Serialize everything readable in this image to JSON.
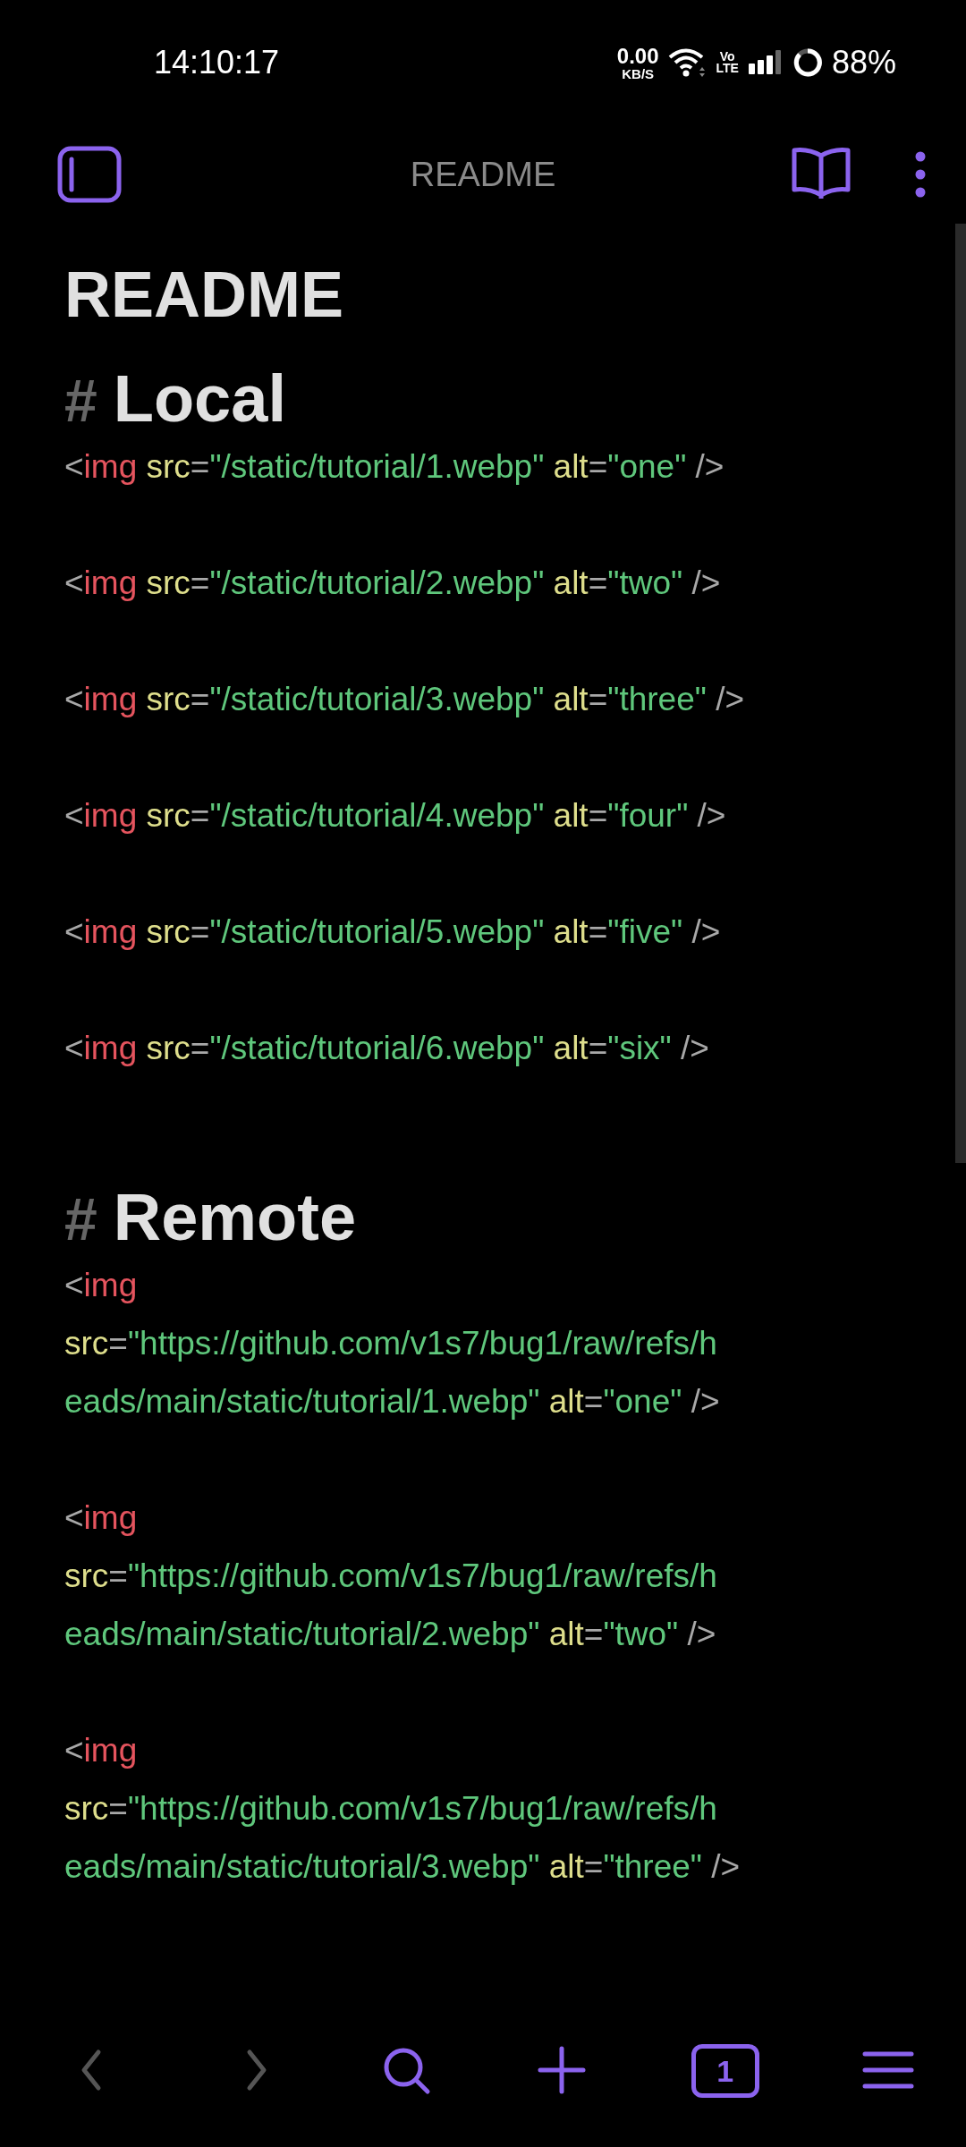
{
  "status_bar": {
    "time": "14:10:17",
    "net_speed": "0.00",
    "net_unit": "KB/S",
    "volte_top": "Vo",
    "volte_bottom": "LTE",
    "battery": "88%"
  },
  "top_bar": {
    "title": "README"
  },
  "document": {
    "title": "README",
    "sections": [
      {
        "marker": "#",
        "heading": "Local",
        "blocks": [
          {
            "lines": [
              [
                {
                  "kind": "punct",
                  "text": "<"
                },
                {
                  "kind": "tag",
                  "text": "img"
                },
                {
                  "kind": "attr",
                  "text": " src"
                },
                {
                  "kind": "punct",
                  "text": "="
                },
                {
                  "kind": "string",
                  "text": "\"/static/tutorial/1.webp\""
                },
                {
                  "kind": "attr",
                  "text": " alt"
                },
                {
                  "kind": "punct",
                  "text": "="
                },
                {
                  "kind": "string",
                  "text": "\"one\""
                },
                {
                  "kind": "punct",
                  "text": " />"
                }
              ]
            ]
          },
          {
            "lines": [
              [
                {
                  "kind": "punct",
                  "text": "<"
                },
                {
                  "kind": "tag",
                  "text": "img"
                },
                {
                  "kind": "attr",
                  "text": " src"
                },
                {
                  "kind": "punct",
                  "text": "="
                },
                {
                  "kind": "string",
                  "text": "\"/static/tutorial/2.webp\""
                },
                {
                  "kind": "attr",
                  "text": " alt"
                },
                {
                  "kind": "punct",
                  "text": "="
                },
                {
                  "kind": "string",
                  "text": "\"two\""
                },
                {
                  "kind": "punct",
                  "text": " />"
                }
              ]
            ]
          },
          {
            "lines": [
              [
                {
                  "kind": "punct",
                  "text": "<"
                },
                {
                  "kind": "tag",
                  "text": "img"
                },
                {
                  "kind": "attr",
                  "text": " src"
                },
                {
                  "kind": "punct",
                  "text": "="
                },
                {
                  "kind": "string",
                  "text": "\"/static/tutorial/3.webp\""
                },
                {
                  "kind": "attr",
                  "text": " alt"
                },
                {
                  "kind": "punct",
                  "text": "="
                },
                {
                  "kind": "string",
                  "text": "\"three\""
                },
                {
                  "kind": "punct",
                  "text": " />"
                }
              ]
            ]
          },
          {
            "lines": [
              [
                {
                  "kind": "punct",
                  "text": "<"
                },
                {
                  "kind": "tag",
                  "text": "img"
                },
                {
                  "kind": "attr",
                  "text": " src"
                },
                {
                  "kind": "punct",
                  "text": "="
                },
                {
                  "kind": "string",
                  "text": "\"/static/tutorial/4.webp\""
                },
                {
                  "kind": "attr",
                  "text": " alt"
                },
                {
                  "kind": "punct",
                  "text": "="
                },
                {
                  "kind": "string",
                  "text": "\"four\""
                },
                {
                  "kind": "punct",
                  "text": " />"
                }
              ]
            ]
          },
          {
            "lines": [
              [
                {
                  "kind": "punct",
                  "text": "<"
                },
                {
                  "kind": "tag",
                  "text": "img"
                },
                {
                  "kind": "attr",
                  "text": " src"
                },
                {
                  "kind": "punct",
                  "text": "="
                },
                {
                  "kind": "string",
                  "text": "\"/static/tutorial/5.webp\""
                },
                {
                  "kind": "attr",
                  "text": " alt"
                },
                {
                  "kind": "punct",
                  "text": "="
                },
                {
                  "kind": "string",
                  "text": "\"five\""
                },
                {
                  "kind": "punct",
                  "text": " />"
                }
              ]
            ]
          },
          {
            "lines": [
              [
                {
                  "kind": "punct",
                  "text": "<"
                },
                {
                  "kind": "tag",
                  "text": "img"
                },
                {
                  "kind": "attr",
                  "text": " src"
                },
                {
                  "kind": "punct",
                  "text": "="
                },
                {
                  "kind": "string",
                  "text": "\"/static/tutorial/6.webp\""
                },
                {
                  "kind": "attr",
                  "text": " alt"
                },
                {
                  "kind": "punct",
                  "text": "="
                },
                {
                  "kind": "string",
                  "text": "\"six\""
                },
                {
                  "kind": "punct",
                  "text": " />"
                }
              ]
            ]
          }
        ]
      },
      {
        "marker": "#",
        "heading": "Remote",
        "blocks": [
          {
            "lines": [
              [
                {
                  "kind": "punct",
                  "text": "<"
                },
                {
                  "kind": "tag",
                  "text": "img"
                }
              ],
              [
                {
                  "kind": "attr",
                  "text": "src"
                },
                {
                  "kind": "punct",
                  "text": "="
                },
                {
                  "kind": "string",
                  "text": "\"https://github.com/v1s7/bug1/raw/refs/h"
                }
              ],
              [
                {
                  "kind": "string",
                  "text": "eads/main/static/tutorial/1.webp\""
                },
                {
                  "kind": "attr",
                  "text": " alt"
                },
                {
                  "kind": "punct",
                  "text": "="
                },
                {
                  "kind": "string",
                  "text": "\"one\""
                },
                {
                  "kind": "punct",
                  "text": " />"
                }
              ]
            ]
          },
          {
            "lines": [
              [
                {
                  "kind": "punct",
                  "text": "<"
                },
                {
                  "kind": "tag",
                  "text": "img"
                }
              ],
              [
                {
                  "kind": "attr",
                  "text": "src"
                },
                {
                  "kind": "punct",
                  "text": "="
                },
                {
                  "kind": "string",
                  "text": "\"https://github.com/v1s7/bug1/raw/refs/h"
                }
              ],
              [
                {
                  "kind": "string",
                  "text": "eads/main/static/tutorial/2.webp\""
                },
                {
                  "kind": "attr",
                  "text": " alt"
                },
                {
                  "kind": "punct",
                  "text": "="
                },
                {
                  "kind": "string",
                  "text": "\"two\""
                },
                {
                  "kind": "punct",
                  "text": " />"
                }
              ]
            ]
          },
          {
            "lines": [
              [
                {
                  "kind": "punct",
                  "text": "<"
                },
                {
                  "kind": "tag",
                  "text": "img"
                }
              ],
              [
                {
                  "kind": "attr",
                  "text": "src"
                },
                {
                  "kind": "punct",
                  "text": "="
                },
                {
                  "kind": "string",
                  "text": "\"https://github.com/v1s7/bug1/raw/refs/h"
                }
              ],
              [
                {
                  "kind": "string",
                  "text": "eads/main/static/tutorial/3.webp\""
                },
                {
                  "kind": "attr",
                  "text": " alt"
                },
                {
                  "kind": "punct",
                  "text": "="
                },
                {
                  "kind": "string",
                  "text": "\"three\""
                },
                {
                  "kind": "punct",
                  "text": " />"
                }
              ]
            ]
          }
        ]
      }
    ]
  },
  "bottom_bar": {
    "buttons": [
      {
        "kind": "back",
        "disabled": true
      },
      {
        "kind": "forward",
        "disabled": true
      },
      {
        "kind": "search",
        "disabled": false
      },
      {
        "kind": "add",
        "disabled": false
      },
      {
        "kind": "tabs",
        "label": "1",
        "disabled": false
      },
      {
        "kind": "menu",
        "disabled": false
      }
    ]
  }
}
